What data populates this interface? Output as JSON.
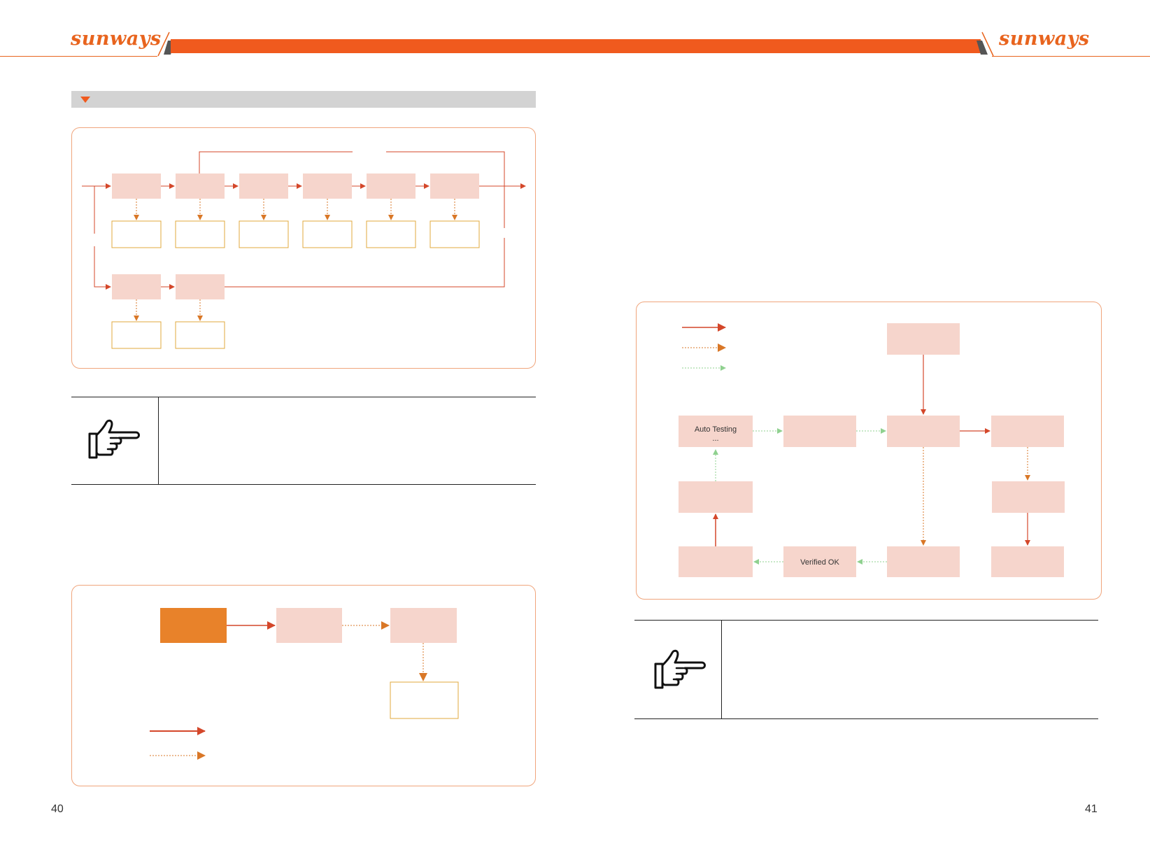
{
  "header": {
    "brand_left": "sunways",
    "brand_right": "sunways"
  },
  "colors": {
    "accent": "#f05a1e",
    "node_fill": "#f6d5cc",
    "output_border": "#e0a83c",
    "solid_arrow": "#d4472a",
    "dotted_arrow": "#d97727",
    "green_arrow": "#8fd18f",
    "start_node": "#e8822a"
  },
  "icons": [
    "pointing-hand-icon",
    "section-triangle-icon"
  ],
  "diagram_c": {
    "auto_testing_label": "Auto Testing",
    "auto_testing_sub": "...",
    "verified_label": "Verified OK"
  },
  "pages": {
    "left_number": "40",
    "right_number": "41"
  }
}
